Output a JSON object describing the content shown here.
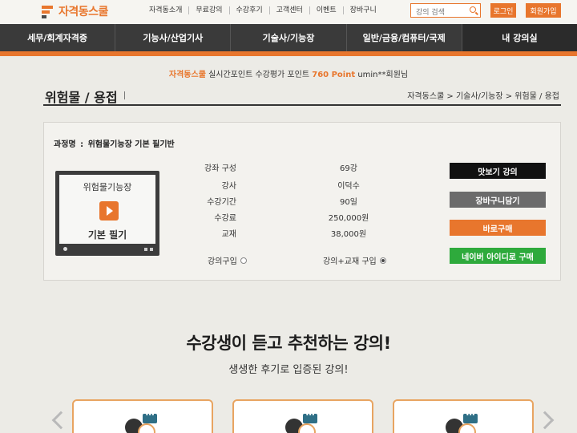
{
  "header": {
    "logo_text": "자격동스쿨",
    "nav": [
      "자격동소개",
      "무료강의",
      "수강후기",
      "고객센터",
      "이벤트",
      "장바구니"
    ],
    "search_placeholder": "강의 검색",
    "login_label": "로그인",
    "join_label": "회원가입"
  },
  "main_nav": [
    "세무/회계자격증",
    "기능사/산업기사",
    "기술사/기능장",
    "일반/금융/컴퓨터/국제",
    "내 강의실"
  ],
  "points_banner": {
    "brand": "자격동스쿨",
    "text": "실시간포인트 수강평가 포인트",
    "points": "760 Point",
    "user": "umin**회원님"
  },
  "page": {
    "title": "위험물 / 용접",
    "breadcrumb": "자격동스쿨 > 기술사/기능장 > 위험물 / 용접"
  },
  "course": {
    "name_label": "과정명",
    "name": "위험물기능장 기본 필기반",
    "thumb_top": "위험물기능장",
    "thumb_bottom": "기본 필기",
    "details": [
      {
        "label": "강좌 구성",
        "value": "69강"
      },
      {
        "label": "강사",
        "value": "이덕수"
      },
      {
        "label": "수강기간",
        "value": "90일"
      },
      {
        "label": "수강료",
        "value": "250,000원"
      },
      {
        "label": "교재",
        "value": "38,000원"
      }
    ],
    "option_lecture": "강의구입",
    "option_lecture_book": "강의+교재 구입",
    "buttons": {
      "preview": "맛보기 강의",
      "cart": "장바구니담기",
      "buy_now": "바로구매",
      "naver": "네이버 아이디로 구매"
    },
    "colors": {
      "preview": "#111111",
      "cart": "#6b6b6b",
      "buy_now": "#e8762d",
      "naver": "#2eaa3c"
    }
  },
  "recommend": {
    "title": "수강생이 듣고 추천하는 강의!",
    "subtitle": "생생한 후기로 입증된 강의!"
  },
  "accent_color": "#e8762d"
}
